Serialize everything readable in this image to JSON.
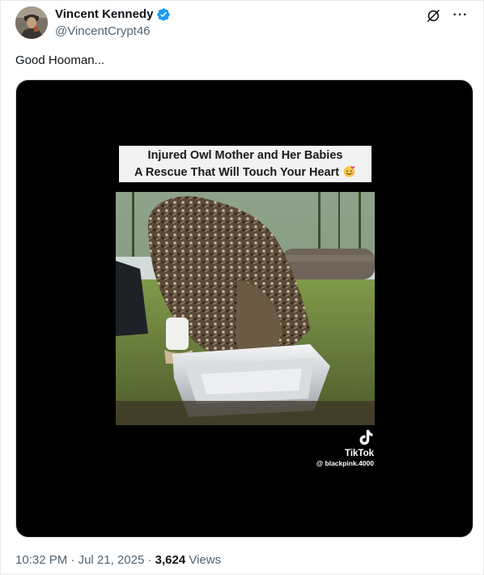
{
  "author": {
    "display_name": "Vincent Kennedy",
    "handle": "@VincentCrypt46",
    "verified": true,
    "avatar_icon": "avatar-photo-icon"
  },
  "tweet": {
    "text": "Good Hooman..."
  },
  "media": {
    "caption_line1": "Injured Owl Mother and Her Babies",
    "caption_line2": "A Rescue That Will Touch Your Heart",
    "caption_emoji": "smiling-face-with-hearts-icon",
    "watermark_label": "TikTok",
    "watermark_user": "@ blackpink.4000"
  },
  "meta": {
    "time": "10:32 PM",
    "separator1": " · ",
    "date": "Jul 21, 2025",
    "separator2": " · ",
    "views_count": "3,624",
    "views_label": " Views"
  },
  "colors": {
    "verified": "#1d9bf0",
    "secondary_text": "#536471",
    "primary_text": "#0f1419"
  }
}
